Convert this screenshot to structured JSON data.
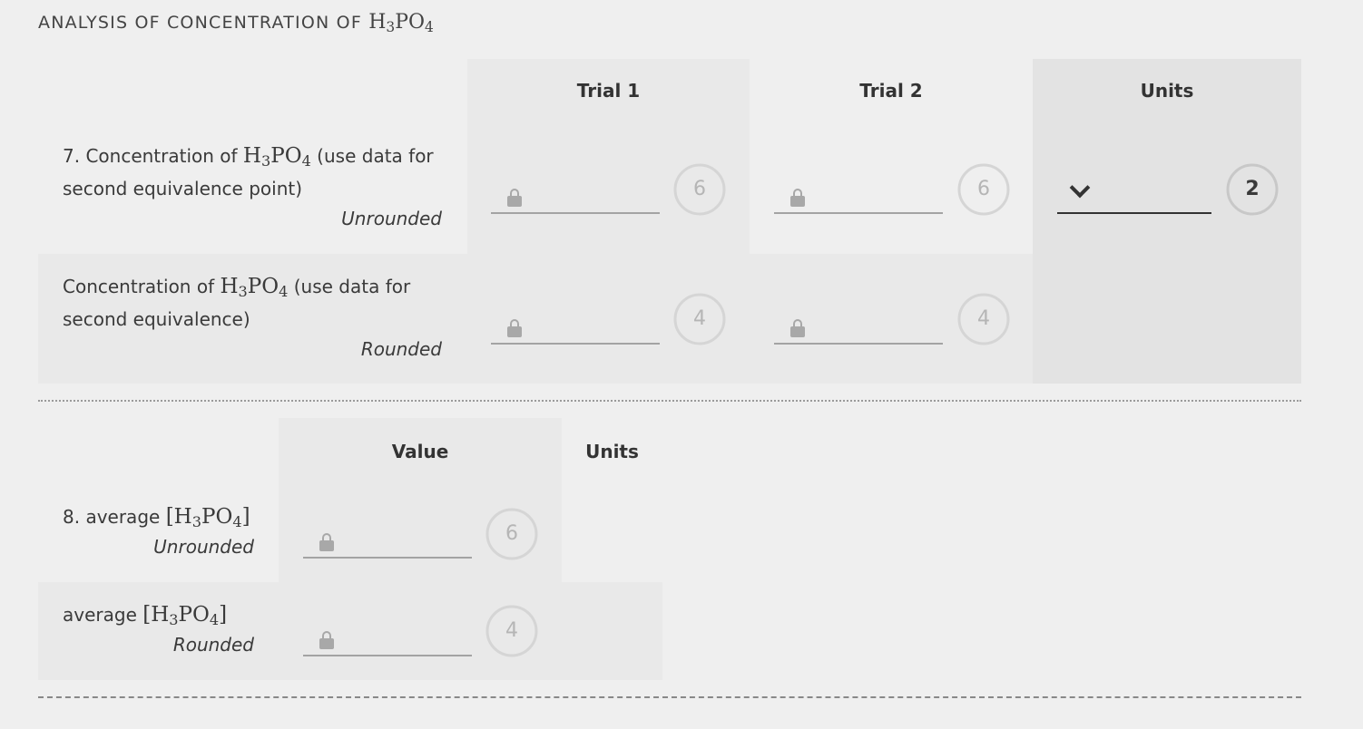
{
  "title": {
    "prefix": "ANALYSIS OF CONCENTRATION OF",
    "formula": {
      "base1": "H",
      "sub1": "3",
      "base2": "PO",
      "sub2": "4"
    }
  },
  "table1": {
    "headers": {
      "trial1": "Trial 1",
      "trial2": "Trial 2",
      "units": "Units"
    },
    "row1": {
      "label_pre": "7. Concentration of",
      "label_post": " (use data for second equivalence point)",
      "qualifier": "Unrounded",
      "trial1_sigfigs": "6",
      "trial2_sigfigs": "6",
      "units_sigfigs": "2"
    },
    "row2": {
      "label_pre": "Concentration of",
      "label_post": " (use data for second equivalence)",
      "qualifier": "Rounded",
      "trial1_sigfigs": "4",
      "trial2_sigfigs": "4"
    }
  },
  "table2": {
    "headers": {
      "value": "Value",
      "units": "Units"
    },
    "row1": {
      "label_pre": "8. average",
      "qualifier": "Unrounded",
      "value_sigfigs": "6"
    },
    "row2": {
      "label_pre": "average",
      "qualifier": "Rounded",
      "value_sigfigs": "4"
    }
  },
  "icons": {
    "lock": "lock-icon",
    "chevron": "chevron-down-icon"
  },
  "colors": {
    "page_bg": "#efefef",
    "shade_light": "#e9e9e9",
    "shade_dark": "#e3e3e3",
    "input_line": "#a3a3a3",
    "muted": "#b5b5b5",
    "text": "#3a3a3a"
  }
}
